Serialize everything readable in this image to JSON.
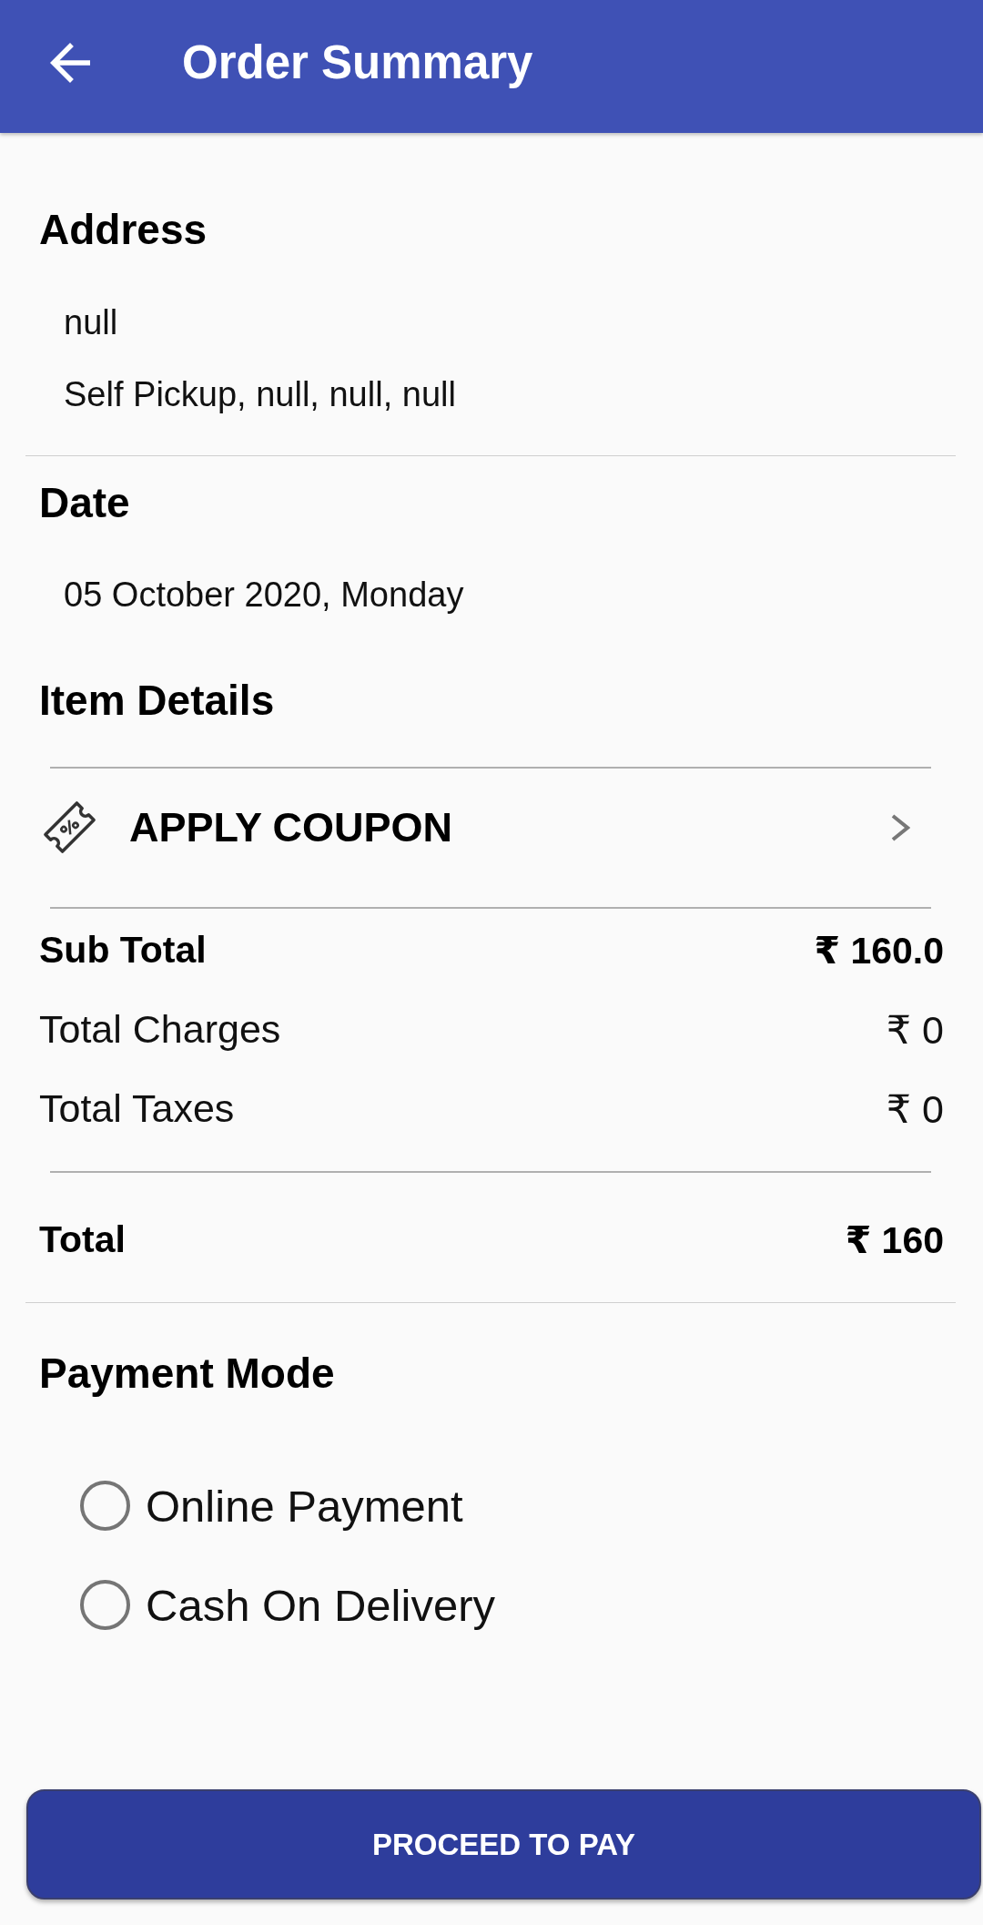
{
  "app_bar": {
    "title": "Order Summary"
  },
  "address": {
    "heading": "Address",
    "lines": [
      "null",
      "Self Pickup, null, null, null"
    ]
  },
  "date": {
    "heading": "Date",
    "value": "05 October 2020, Monday"
  },
  "item_details": {
    "heading": "Item Details"
  },
  "coupon": {
    "label": "APPLY COUPON"
  },
  "charges": [
    {
      "kind": "subtotal",
      "label": "Sub Total",
      "value": "₹ 160.0"
    },
    {
      "kind": "line",
      "label": "Total Charges",
      "value": "₹ 0"
    },
    {
      "kind": "line",
      "label": "Total Taxes",
      "value": "₹ 0"
    }
  ],
  "total": {
    "label": "Total",
    "value": "₹ 160"
  },
  "payment_mode": {
    "heading": "Payment Mode",
    "options": [
      {
        "label": "Online Payment",
        "selected": false
      },
      {
        "label": "Cash On Delivery",
        "selected": false
      }
    ]
  },
  "primary_button": {
    "label": "PROCEED TO PAY"
  }
}
